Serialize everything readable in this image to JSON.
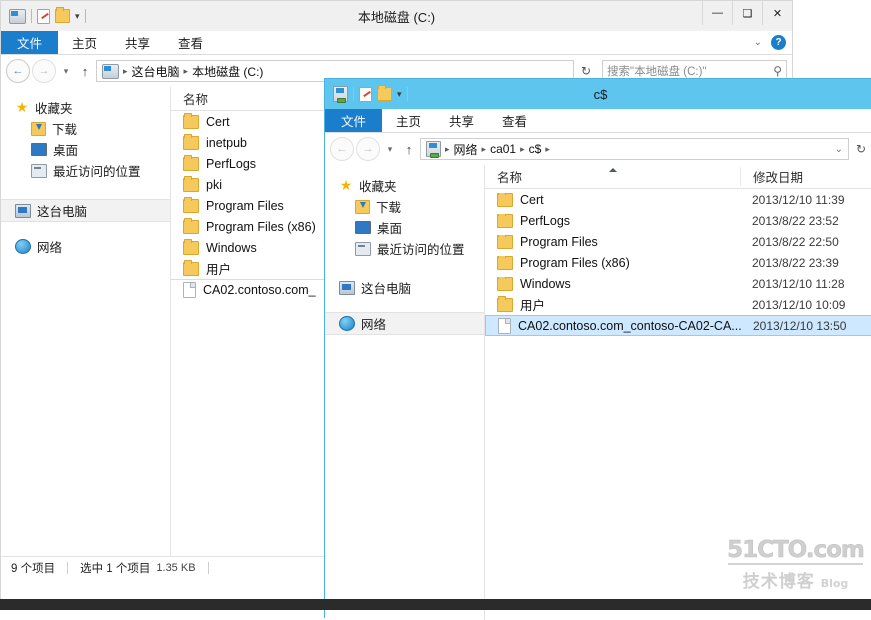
{
  "desktop": {
    "background": "#ffffff",
    "taskbar_color": "#2b2b2b"
  },
  "watermark": {
    "top": "51CTO.com",
    "bottom_cn": "技术博客",
    "bottom_en": "Blog"
  },
  "window1": {
    "title": "本地磁盘 (C:)",
    "active": false,
    "quick_access": [
      "drive-icon",
      "properties-icon",
      "new-folder-icon",
      "customize-caret"
    ],
    "controls": {
      "minimize": "—",
      "maximize": "❑",
      "close": "✕"
    },
    "ribbon": {
      "tabs": [
        {
          "label": "文件",
          "active": true
        },
        {
          "label": "主页",
          "active": false
        },
        {
          "label": "共享",
          "active": false
        },
        {
          "label": "查看",
          "active": false
        }
      ],
      "collapse_caret": "⌄",
      "help": "?"
    },
    "address": {
      "back": "←",
      "forward": "→",
      "history_caret": "▾",
      "up": "↑",
      "breadcrumb": [
        "这台电脑",
        "本地磁盘 (C:)"
      ],
      "separator": "▸",
      "refresh": "↻",
      "search_placeholder": "搜索\"本地磁盘 (C:)\"",
      "search_value": "",
      "search_icon": "⚲"
    },
    "nav_pane": {
      "groups": [
        {
          "header": {
            "label": "收藏夹",
            "icon": "star-icon"
          },
          "items": [
            {
              "label": "下载",
              "icon": "downloads-icon"
            },
            {
              "label": "桌面",
              "icon": "desktop-icon"
            },
            {
              "label": "最近访问的位置",
              "icon": "recent-places-icon"
            }
          ]
        },
        {
          "header": {
            "label": "这台电脑",
            "icon": "this-pc-icon",
            "selected": true
          },
          "items": []
        },
        {
          "header": {
            "label": "网络",
            "icon": "network-icon"
          },
          "items": []
        }
      ]
    },
    "list": {
      "columns": [
        {
          "label": "名称",
          "sorted": "asc"
        }
      ],
      "rows": [
        {
          "name": "Cert",
          "type": "folder"
        },
        {
          "name": "inetpub",
          "type": "folder"
        },
        {
          "name": "PerfLogs",
          "type": "folder"
        },
        {
          "name": "pki",
          "type": "folder"
        },
        {
          "name": "Program Files",
          "type": "folder"
        },
        {
          "name": "Program Files (x86)",
          "type": "folder"
        },
        {
          "name": "Windows",
          "type": "folder"
        },
        {
          "name": "用户",
          "type": "folder"
        },
        {
          "name": "CA02.contoso.com_",
          "type": "file",
          "selected": true
        }
      ]
    },
    "status": {
      "item_count": "9 个项目",
      "selection": "选中 1 个项目",
      "size": "1.35 KB"
    }
  },
  "window2": {
    "title": "c$",
    "active": true,
    "title_color": "#5ec5ee",
    "quick_access": [
      "share-icon",
      "properties-icon",
      "new-folder-icon",
      "customize-caret"
    ],
    "ribbon": {
      "tabs": [
        {
          "label": "文件",
          "active": true
        },
        {
          "label": "主页",
          "active": false
        },
        {
          "label": "共享",
          "active": false
        },
        {
          "label": "查看",
          "active": false
        }
      ],
      "collapse_caret": "⌄"
    },
    "address": {
      "back": "←",
      "forward": "→",
      "history_caret": "▾",
      "up": "↑",
      "breadcrumb": [
        "网络",
        "ca01",
        "c$"
      ],
      "separator": "▸",
      "refresh": "↻",
      "dropdown_caret": "⌄"
    },
    "nav_pane": {
      "groups": [
        {
          "header": {
            "label": "收藏夹",
            "icon": "star-icon"
          },
          "items": [
            {
              "label": "下载",
              "icon": "downloads-icon"
            },
            {
              "label": "桌面",
              "icon": "desktop-icon"
            },
            {
              "label": "最近访问的位置",
              "icon": "recent-places-icon"
            }
          ]
        },
        {
          "header": {
            "label": "这台电脑",
            "icon": "this-pc-icon"
          },
          "items": []
        },
        {
          "header": {
            "label": "网络",
            "icon": "network-icon",
            "selected": true
          },
          "items": []
        }
      ]
    },
    "list": {
      "columns": [
        {
          "label": "名称",
          "sorted": "asc"
        },
        {
          "label": "修改日期",
          "sorted": "none"
        }
      ],
      "rows": [
        {
          "name": "Cert",
          "type": "folder",
          "modified": "2013/12/10 11:39"
        },
        {
          "name": "PerfLogs",
          "type": "folder",
          "modified": "2013/8/22 23:52"
        },
        {
          "name": "Program Files",
          "type": "folder",
          "modified": "2013/8/22 22:50"
        },
        {
          "name": "Program Files (x86)",
          "type": "folder",
          "modified": "2013/8/22 23:39"
        },
        {
          "name": "Windows",
          "type": "folder",
          "modified": "2013/12/10 11:28"
        },
        {
          "name": "用户",
          "type": "folder",
          "modified": "2013/12/10 10:09"
        },
        {
          "name": "CA02.contoso.com_contoso-CA02-CA...",
          "type": "file",
          "modified": "2013/12/10 13:50",
          "selected": true
        }
      ]
    }
  }
}
